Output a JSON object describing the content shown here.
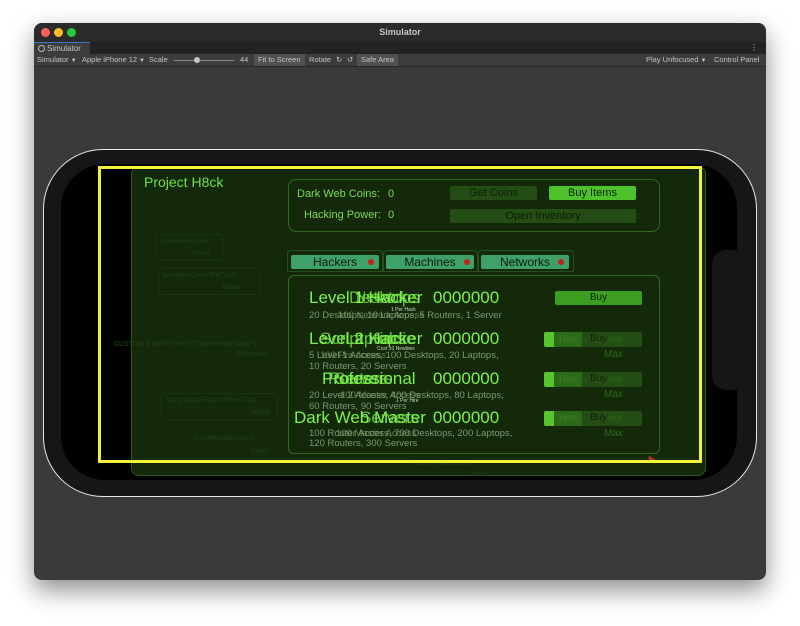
{
  "window": {
    "title": "Simulator"
  },
  "tab": {
    "label": "Simulator",
    "icon": "gear-icon"
  },
  "toolbar": {
    "mode": "Simulator",
    "device": "Apple iPhone 12",
    "scale_label": "Scale",
    "scale_value": "44",
    "fit_to_screen": "Fit to Screen",
    "rotate": "Rotate",
    "safe_area": "Safe Area",
    "play_mode": "Play Unfocused",
    "control_panel": "Control Panel"
  },
  "game": {
    "title": "Project H8ck",
    "stats": {
      "coins_label": "Dark Web Coins:",
      "coins_value": "0",
      "power_label": "Hacking Power:",
      "power_value": "0"
    },
    "buttons": {
      "get_coins": "Get Coins",
      "buy_items": "Buy Items",
      "open_inventory": "Open Inventory"
    },
    "tabs": [
      {
        "label": "Hackers",
        "alert": true
      },
      {
        "label": "Machines",
        "alert": true
      },
      {
        "label": "Networks",
        "alert": true
      }
    ],
    "rows": [
      {
        "name_layers": [
          "Level 1 Hacker",
          "Desktops",
          "Network"
        ],
        "value": "0000000",
        "desc_layers": [
          "20 Desktops, 10 Laptops, 5 Routers, 1 Server",
          "100 Network Access"
        ],
        "rate": "1 Per Hack",
        "buttons": {
          "buy": "Buy"
        }
      },
      {
        "name_layers": [
          "Level 2 Hacker",
          "Script Kiddie",
          "Laptops"
        ],
        "value": "0000000",
        "desc_layers": [
          "5 Level 1 Access, 100 Desktops, 20 Laptops,",
          "10 Routers, 20 Servers",
          "100 Pro Access"
        ],
        "rate": "Cost 10 Newbies",
        "buttons": {
          "hire": "Hire",
          "buy": "Buy",
          "hire_max": "Hire Max"
        }
      },
      {
        "name_layers": [
          "Professional",
          "Routers",
          "Servers"
        ],
        "value": "0000000",
        "desc_layers": [
          "20 Level 2 Access, 400 Desktops, 80 Laptops,",
          "60 Routers, 90 Servers",
          "100 Master Access"
        ],
        "rate": "1 Per Hire",
        "buttons": {
          "hire": "Hire",
          "buy": "Buy",
          "hire_max": "Hire Max"
        }
      },
      {
        "name_layers": [
          "Dark Web Master",
          "Servers"
        ],
        "value": "0000000",
        "desc_layers": [
          "100 Router Access, 700 Desktops, 200 Laptops,",
          "120 Routers, 300 Servers",
          "100 Master Access"
        ],
        "buttons": {
          "hire": "Hire",
          "buy": "Buy",
          "hire_max": "Hire Max"
        }
      }
    ],
    "background_nodes": [
      "SnowbieCount",
      "Value",
      "SnowbieCountPerTick",
      "Value",
      "CUSTOM EVENT (Self) (\"BuyScriptKiddie\")",
      "Received",
      "ScriptKiddieCountPerClick",
      "Value",
      "ScriptKiddieCount",
      "Value",
      "ScriptKiddieCost",
      "Value"
    ]
  },
  "colors": {
    "accent_green": "#4ec22a",
    "text_green": "#7cf24d",
    "safe_area_outline": "#f2f23a",
    "alert_dot": "#c3201f"
  }
}
